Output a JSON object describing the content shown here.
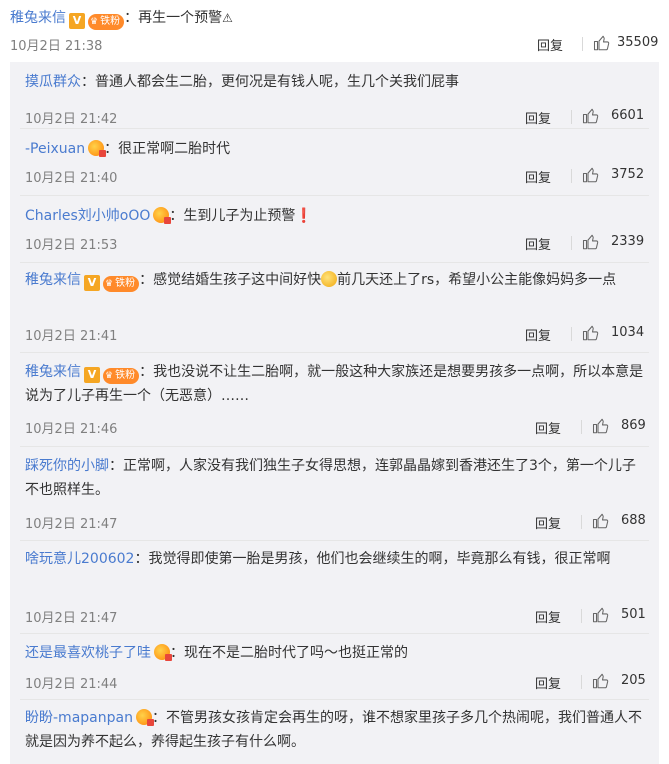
{
  "main": {
    "username": "稚兔来信",
    "badge_v": "V",
    "fan_badge": "铁粉",
    "text": "：再生一个预警",
    "warn_glyph": "⚠",
    "date": "10月2日 21:38",
    "reply_label": "回复",
    "likes": "35509"
  },
  "replies": [
    {
      "username": "摸瓜群众",
      "badges": [],
      "text": "：普通人都会生二胎，更何况是有钱人呢，生几个关我们屁事",
      "date": "10月2日 21:42",
      "reply_label": "回复",
      "likes": "6601"
    },
    {
      "username": "-Peixuan",
      "badges": [
        "vip"
      ],
      "text": "：很正常啊二胎时代",
      "date": "10月2日 21:40",
      "reply_label": "回复",
      "likes": "3752"
    },
    {
      "username": "Charles刘小帅oOO",
      "badges": [
        "vip"
      ],
      "text": "：生到儿子为止预警❗",
      "date": "10月2日 21:53",
      "reply_label": "回复",
      "likes": "2339"
    },
    {
      "username": "稚兔来信",
      "badges": [
        "v",
        "fan"
      ],
      "text_a": "：感觉结婚生孩子这中间好快",
      "text_b": "前几天还上了rs，希望小公主能像妈妈多一点",
      "date": "10月2日 21:41",
      "reply_label": "回复",
      "likes": "1034"
    },
    {
      "username": "稚兔来信",
      "badges": [
        "v",
        "fan"
      ],
      "text": "：我也没说不让生二胎啊，就一般这种大家族还是想要男孩多一点啊，所以本意是说为了儿子再生一个（无恶意）……",
      "date": "10月2日 21:46",
      "reply_label": "回复",
      "likes": "869"
    },
    {
      "username": "踩死你的小脚",
      "badges": [],
      "text": "：正常啊，人家没有我们独生子女得思想，连郭晶晶嫁到香港还生了3个，第一个儿子不也照样生。",
      "date": "10月2日 21:47",
      "reply_label": "回复",
      "likes": "688"
    },
    {
      "username": "啥玩意儿200602",
      "badges": [],
      "text": "：我觉得即使第一胎是男孩，他们也会继续生的啊，毕竟那么有钱，很正常啊",
      "date": "10月2日 21:47",
      "reply_label": "回复",
      "likes": "501"
    },
    {
      "username": "还是最喜欢桃子了哇",
      "badges": [
        "vip"
      ],
      "text": "：现在不是二胎时代了吗～也挺正常的",
      "date": "10月2日 21:44",
      "reply_label": "回复",
      "likes": "205"
    },
    {
      "username": "盼盼-mapanpan",
      "badges": [
        "vip"
      ],
      "text": "：不管男孩女孩肯定会再生的呀，谁不想家里孩子多几个热闹呢，我们普通人不就是因为养不起么，养得起生孩子有什么啊。"
    }
  ]
}
